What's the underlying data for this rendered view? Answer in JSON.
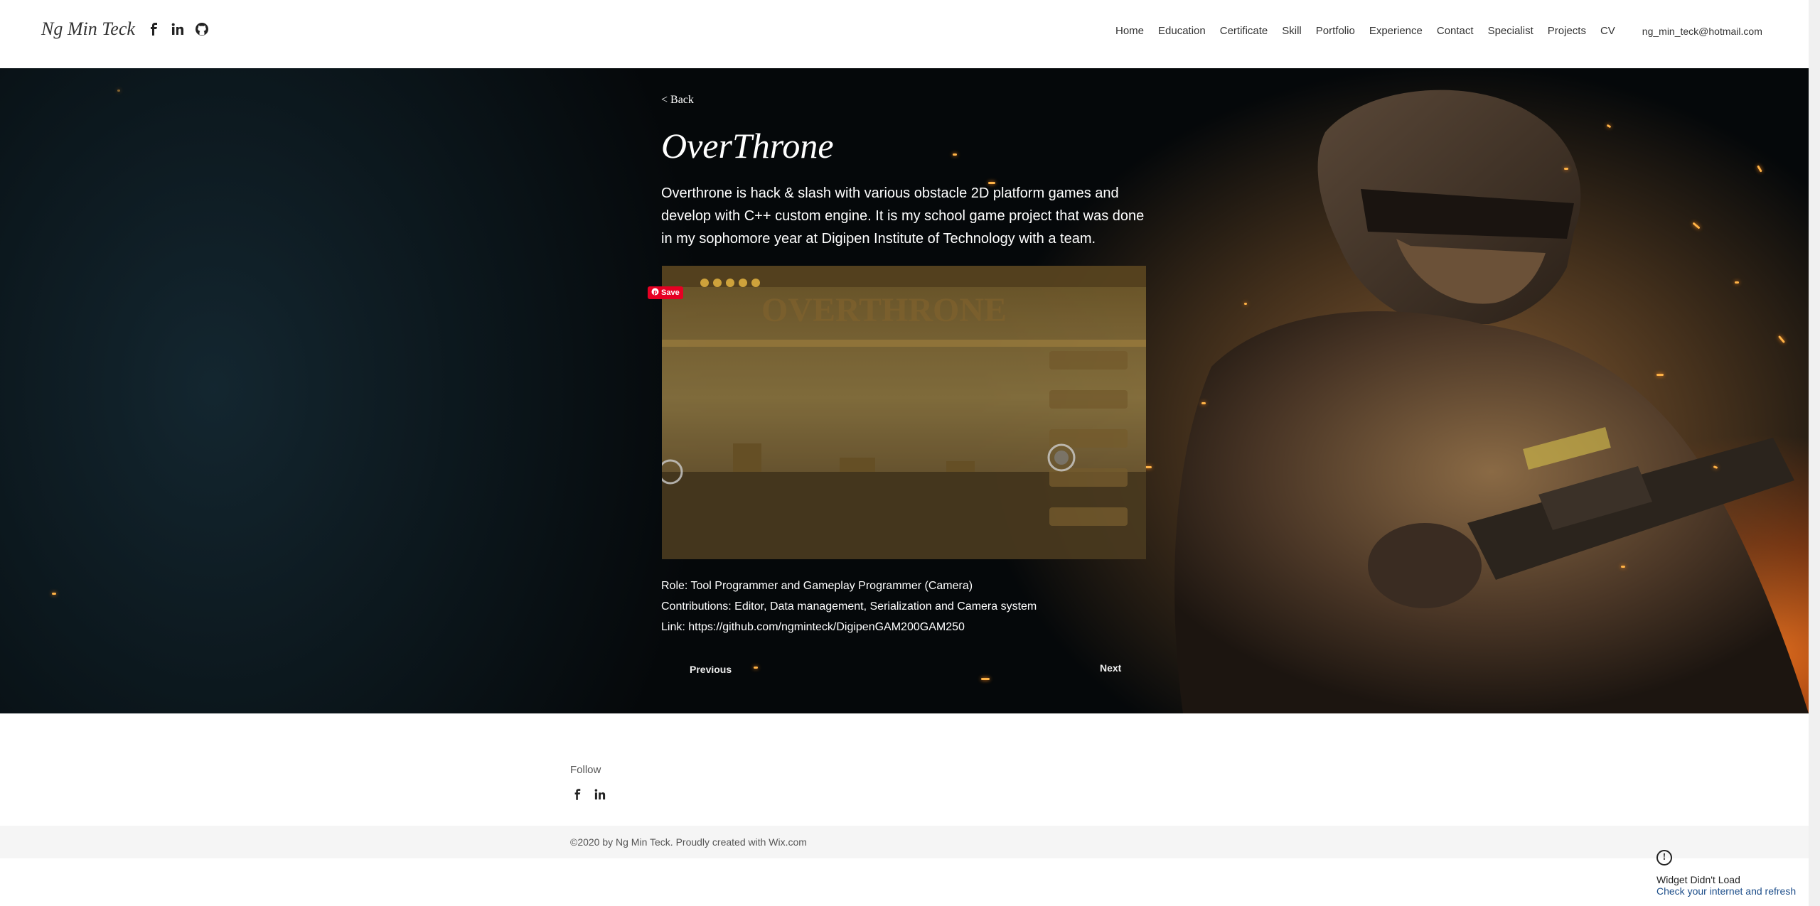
{
  "header": {
    "logo": "Ng Min Teck",
    "nav": [
      "Home",
      "Education",
      "Certificate",
      "Skill",
      "Portfolio",
      "Experience",
      "Contact",
      "Specialist",
      "Projects",
      "CV"
    ],
    "email": "ng_min_teck@hotmail.com"
  },
  "project": {
    "back": "< Back",
    "title": "OverThrone",
    "description": "Overthrone is hack & slash with various obstacle 2D platform games and develop with C++ custom engine. It is my school game project that was done in my sophomore year at Digipen Institute of Technology with a team.",
    "save_label": "Save",
    "role": "Role: Tool Programmer and Gameplay Programmer (Camera)",
    "contributions": "Contributions: Editor, Data management, Serialization and Camera system",
    "link": "Link: https://github.com/ngminteck/DigipenGAM200GAM250",
    "previous": "Previous",
    "next": "Next"
  },
  "footer": {
    "follow": "Follow",
    "copyright": "©2020 by Ng Min Teck. Proudly created with Wix.com"
  },
  "widget": {
    "title": "Widget Didn't Load",
    "subtitle": "Check your internet and refresh"
  },
  "colors": {
    "accent_pinterest": "#e60023",
    "hero_dark": "#0b1419",
    "hero_fire": "#ff7a1a"
  }
}
